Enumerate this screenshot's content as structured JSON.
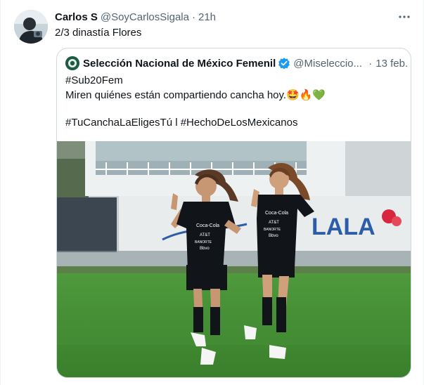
{
  "tweet": {
    "author_name": "Carlos S",
    "author_handle": "@SoyCarlosSigala",
    "separator": "·",
    "time": "21h",
    "text": "2/3 dinastía Flores",
    "more_icon": "more-horizontal-icon"
  },
  "quote": {
    "author_name": "Selección Nacional de México Femenil",
    "author_handle": "@Miseleccio...",
    "separator": "·",
    "date": "13 feb.",
    "verified_icon": "verified-badge-icon",
    "lines": [
      "#Sub20Fem",
      "Miren quiénes están compartiendo cancha hoy.",
      "",
      "#TuCanchaLaEligesTú l #HechoDeLosMexicanos"
    ],
    "emojis": "🤩🔥💚",
    "media": {
      "banner_text": "LALA",
      "shirt_sponsor": "Coca-Cola",
      "shirt_line2": "AT&T",
      "shirt_line3": "BANORTE",
      "shirt_line4": "Bbvo"
    }
  },
  "colors": {
    "text": "#0f1419",
    "muted": "#536471",
    "border": "#cfd9de",
    "verified": "#1d9bf0",
    "pitch": "#3f8a32"
  }
}
